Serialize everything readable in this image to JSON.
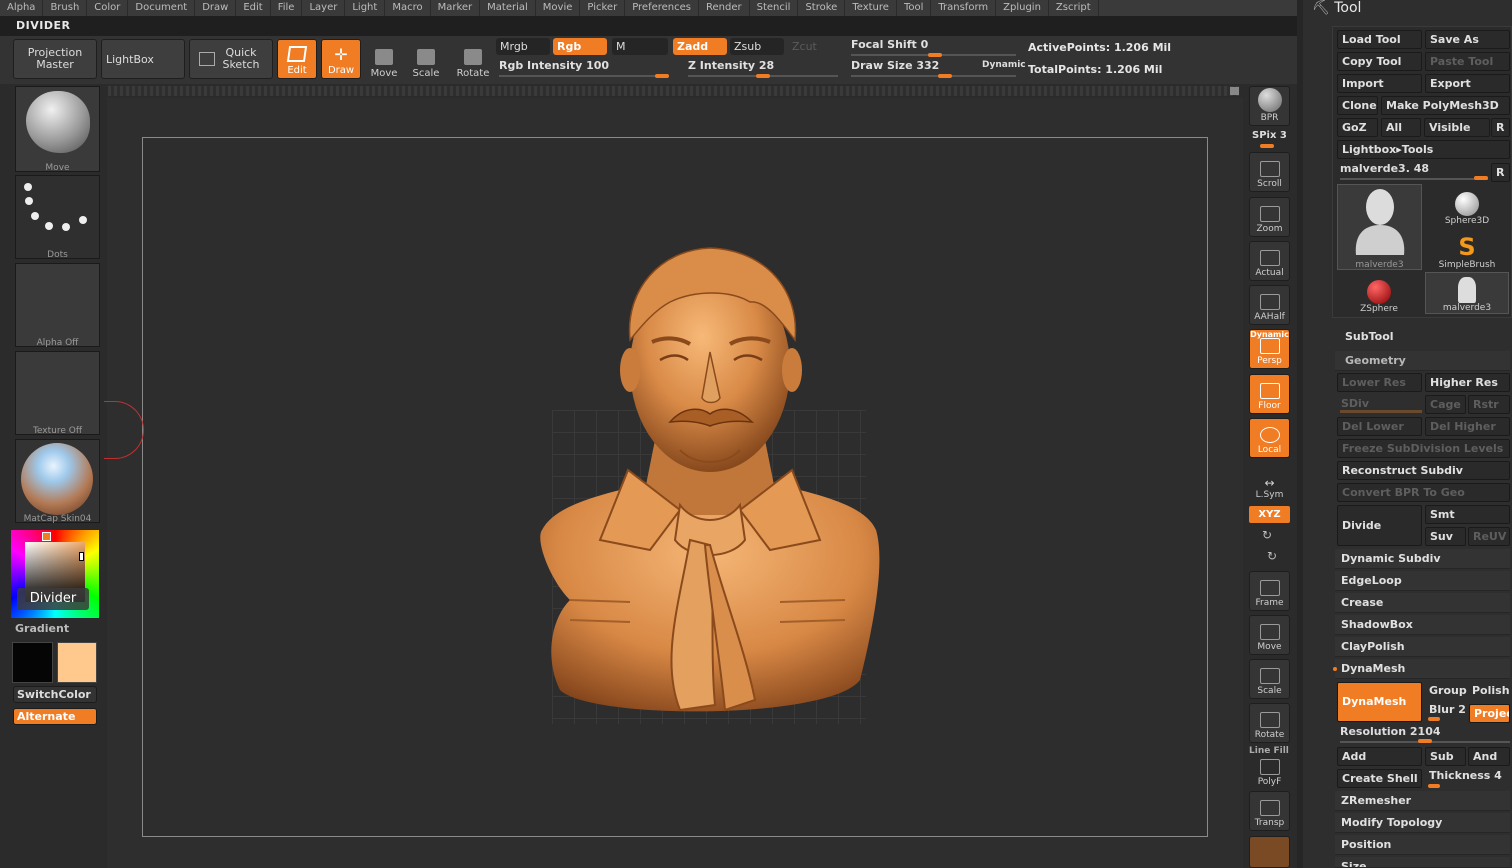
{
  "menu": [
    "Alpha",
    "Brush",
    "Color",
    "Document",
    "Draw",
    "Edit",
    "File",
    "Layer",
    "Light",
    "Macro",
    "Marker",
    "Material",
    "Movie",
    "Picker",
    "Preferences",
    "Render",
    "Stencil",
    "Stroke",
    "Texture",
    "Tool",
    "Transform",
    "Zplugin",
    "Zscript"
  ],
  "title": "DIVIDER",
  "shelf": {
    "projection_master": "Projection Master",
    "lightbox": "LightBox",
    "quick_sketch": "Quick Sketch",
    "edit": "Edit",
    "draw": "Draw",
    "move": "Move",
    "scale": "Scale",
    "rotate": "Rotate",
    "mrgb": "Mrgb",
    "rgb": "Rgb",
    "m": "M",
    "zadd": "Zadd",
    "zsub": "Zsub",
    "zcut": "Zcut",
    "rgb_intensity": "Rgb Intensity 100",
    "z_intensity": "Z Intensity 28",
    "focal_shift": "Focal Shift 0",
    "draw_size": "Draw Size 332",
    "dynamic": "Dynamic",
    "active_points": "ActivePoints: 1.206 Mil",
    "total_points": "TotalPoints: 1.206 Mil"
  },
  "left": {
    "brush": "Move",
    "stroke": "Dots",
    "alpha": "Alpha Off",
    "texture": "Texture Off",
    "material": "MatCap Skin04",
    "color_popup": "Divider",
    "gradient": "Gradient",
    "switchcolor": "SwitchColor",
    "alternate": "Alternate"
  },
  "rightstrip": {
    "bpr": "BPR",
    "spix": "SPix 3",
    "scroll": "Scroll",
    "zoom": "Zoom",
    "actual": "Actual",
    "aahalf": "AAHalf",
    "dynamic": "Dynamic",
    "persp": "Persp",
    "floor": "Floor",
    "local": "Local",
    "lsym": "L.Sym",
    "xyz": "XYZ",
    "frame": "Frame",
    "move": "Move",
    "scale": "Scale",
    "rotate": "Rotate",
    "linefill": "Line Fill",
    "polyf": "PolyF",
    "transp": "Transp"
  },
  "tool": {
    "title": "Tool",
    "load_tool": "Load Tool",
    "save_as": "Save As",
    "copy_tool": "Copy Tool",
    "paste_tool": "Paste Tool",
    "import": "Import",
    "export": "Export",
    "clone": "Clone",
    "make_polymesh": "Make PolyMesh3D",
    "goz": "GoZ",
    "all": "All",
    "visible": "Visible",
    "r": "R",
    "lightbox_tools": "Lightbox▸Tools",
    "current_tool": "malverde3. 48",
    "thumbs": [
      "malverde3",
      "Sphere3D",
      "SimpleBrush",
      "ZSphere",
      "malverde3"
    ],
    "subtool": "SubTool",
    "geometry": "Geometry",
    "lower_res": "Lower Res",
    "higher_res": "Higher Res",
    "sdiv": "SDiv",
    "cage": "Cage",
    "rstr": "Rstr",
    "del_lower": "Del Lower",
    "del_higher": "Del Higher",
    "freeze": "Freeze SubDivision Levels",
    "reconstruct": "Reconstruct Subdiv",
    "convert_bpr": "Convert BPR To Geo",
    "divide": "Divide",
    "smt": "Smt",
    "suv": "Suv",
    "reuv": "ReUV",
    "dynamic_subdiv": "Dynamic Subdiv",
    "edgeloop": "EdgeLoop",
    "crease": "Crease",
    "shadowbox": "ShadowBox",
    "claypolish": "ClayPolish",
    "dynamesh_header": "DynaMesh",
    "dynamesh_btn": "DynaMesh",
    "groups": "Groups",
    "polish": "Polish",
    "blur": "Blur 2",
    "project": "Projec",
    "resolution": "Resolution 2104",
    "add": "Add",
    "sub": "Sub",
    "and": "And",
    "create_shell": "Create Shell",
    "thickness": "Thickness 4",
    "zremesher": "ZRemesher",
    "modify_topology": "Modify Topology",
    "position": "Position",
    "size": "Size"
  },
  "colors": {
    "accent": "#f07c24",
    "bg": "#2b2b2b",
    "panel": "#2e2e2e"
  }
}
